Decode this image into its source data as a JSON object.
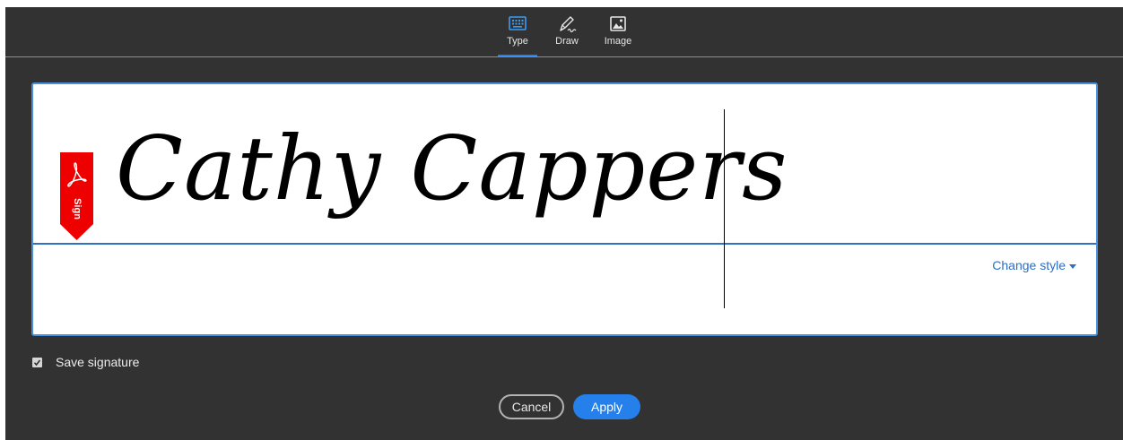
{
  "tabs": [
    {
      "label": "Type",
      "icon": "keyboard-icon",
      "active": true
    },
    {
      "label": "Draw",
      "icon": "pen-draw-icon",
      "active": false
    },
    {
      "label": "Image",
      "icon": "image-icon",
      "active": false
    }
  ],
  "signature": {
    "text": "Cathy Cappers",
    "badge_label": "Sign",
    "badge_color": "#ee0000",
    "change_style_label": "Change style"
  },
  "save_signature": {
    "label": "Save signature",
    "checked": true
  },
  "buttons": {
    "cancel": "Cancel",
    "apply": "Apply"
  },
  "colors": {
    "accent": "#2680eb",
    "background": "#323232"
  }
}
